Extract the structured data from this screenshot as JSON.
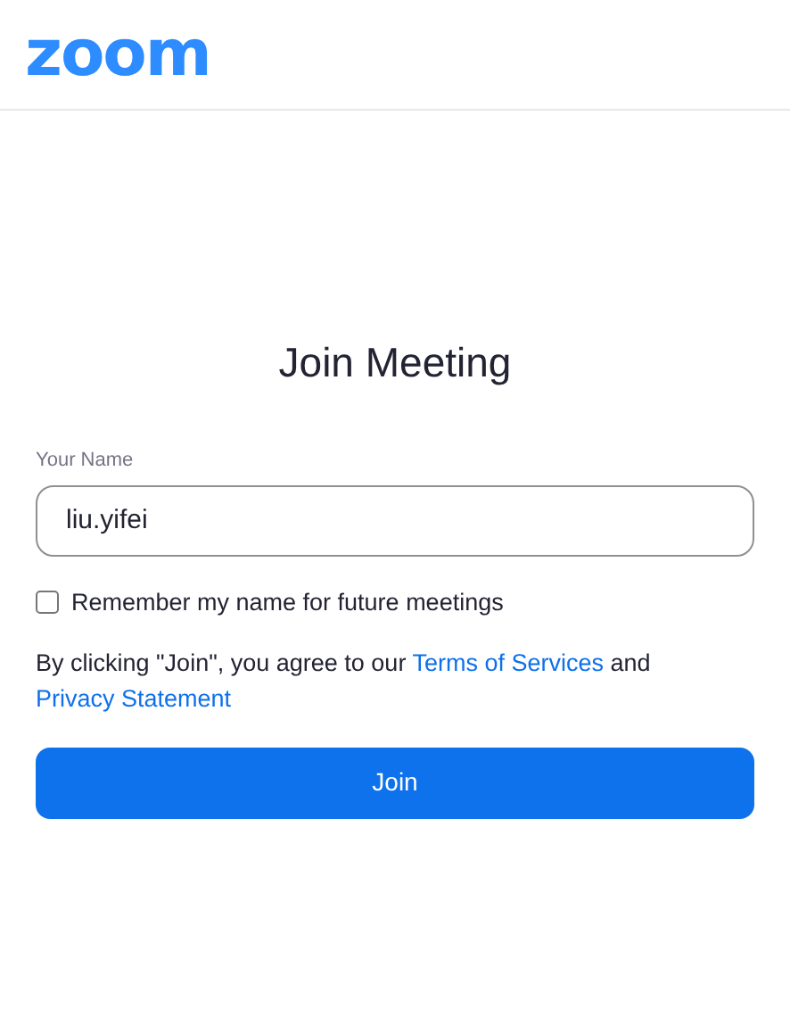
{
  "header": {
    "logo": "zoom"
  },
  "title": "Join Meeting",
  "name_field": {
    "label": "Your Name",
    "value": "liu.yifei"
  },
  "remember": {
    "label": "Remember my name for future meetings",
    "checked": false
  },
  "consent": {
    "text": "By clicking \"Join\", you agree to our",
    "terms_link": "Terms of Services",
    "joiner": "and",
    "privacy_link": "Privacy Statement"
  },
  "join_button": {
    "label": "Join"
  }
}
